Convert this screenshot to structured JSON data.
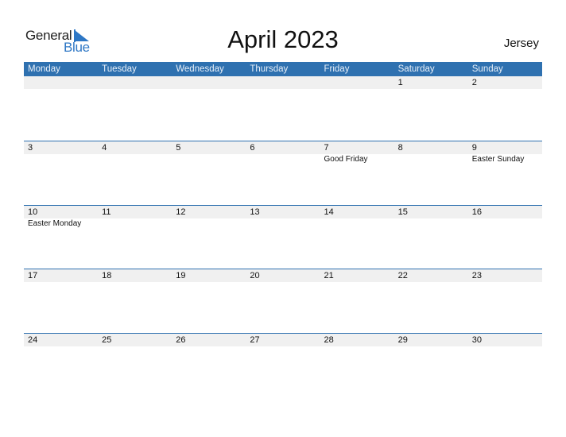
{
  "logo": {
    "line1": "General",
    "line2": "Blue"
  },
  "title": "April 2023",
  "region": "Jersey",
  "colors": {
    "accent": "#2f71b0",
    "date_strip": "#f0f0f0",
    "logo_blue": "#2e77c5"
  },
  "weekdays": [
    "Monday",
    "Tuesday",
    "Wednesday",
    "Thursday",
    "Friday",
    "Saturday",
    "Sunday"
  ],
  "weeks": [
    {
      "days": [
        "",
        "",
        "",
        "",
        "",
        "1",
        "2"
      ],
      "events": [
        "",
        "",
        "",
        "",
        "",
        "",
        ""
      ]
    },
    {
      "days": [
        "3",
        "4",
        "5",
        "6",
        "7",
        "8",
        "9"
      ],
      "events": [
        "",
        "",
        "",
        "",
        "Good Friday",
        "",
        "Easter Sunday"
      ]
    },
    {
      "days": [
        "10",
        "11",
        "12",
        "13",
        "14",
        "15",
        "16"
      ],
      "events": [
        "Easter Monday",
        "",
        "",
        "",
        "",
        "",
        ""
      ]
    },
    {
      "days": [
        "17",
        "18",
        "19",
        "20",
        "21",
        "22",
        "23"
      ],
      "events": [
        "",
        "",
        "",
        "",
        "",
        "",
        ""
      ]
    },
    {
      "days": [
        "24",
        "25",
        "26",
        "27",
        "28",
        "29",
        "30"
      ],
      "events": [
        "",
        "",
        "",
        "",
        "",
        "",
        ""
      ]
    }
  ]
}
